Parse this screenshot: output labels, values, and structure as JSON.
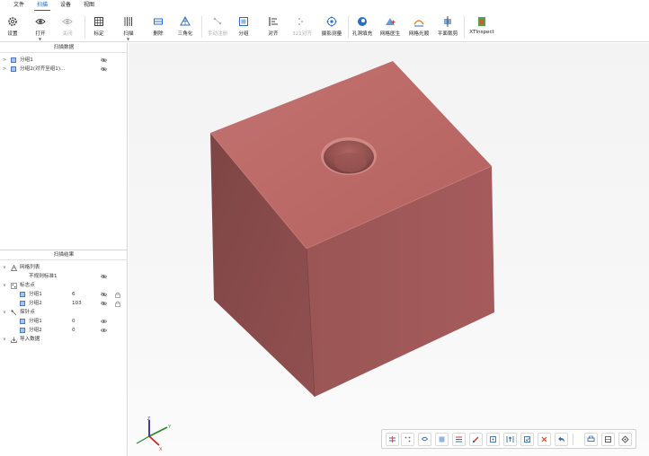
{
  "menubar": {
    "items": [
      {
        "label": "文件",
        "active": false
      },
      {
        "label": "扫描",
        "active": true
      },
      {
        "label": "设备",
        "active": false
      },
      {
        "label": "视图",
        "active": false
      }
    ]
  },
  "toolbar": {
    "settings": "设置",
    "open": "打开",
    "close": "关闭",
    "calibrate": "标定",
    "scan": "扫描",
    "delete": "删除",
    "triangulate": "三角化",
    "manual_register": "手动注册",
    "group": "分组",
    "align": "对齐",
    "align321": "321对齐",
    "photogrammetry": "摄影测量",
    "hole_fill": "孔洞填充",
    "mesh_doctor": "网格医生",
    "mesh_smooth": "网格光顺",
    "plane_clip": "平面裁剪",
    "xtinspect": "XTInspect"
  },
  "scan_data": {
    "title": "扫描数据",
    "groups": [
      {
        "label": "分组1"
      },
      {
        "label": "分组2(对齐至组1)..."
      }
    ]
  },
  "scan_results": {
    "title": "扫描结果",
    "mesh_list": {
      "label": "网格列表",
      "items": [
        {
          "label": "不规则标准1"
        }
      ]
    },
    "marker_points": {
      "label": "标志点",
      "items": [
        {
          "label": "分组1",
          "count": "6"
        },
        {
          "label": "分组2",
          "count": "103"
        }
      ]
    },
    "probe_points": {
      "label": "探针点",
      "items": [
        {
          "label": "分组1",
          "count": "0"
        },
        {
          "label": "分组2",
          "count": "0"
        }
      ]
    },
    "import_data": {
      "label": "导入数据"
    }
  },
  "axis": {
    "x": "X",
    "y": "Y",
    "z": "Z"
  },
  "colors": {
    "accent": "#1f5fbf",
    "cube_top": "#bd6e6c",
    "cube_left": "#8d4f4f",
    "cube_right": "#9e5656"
  }
}
